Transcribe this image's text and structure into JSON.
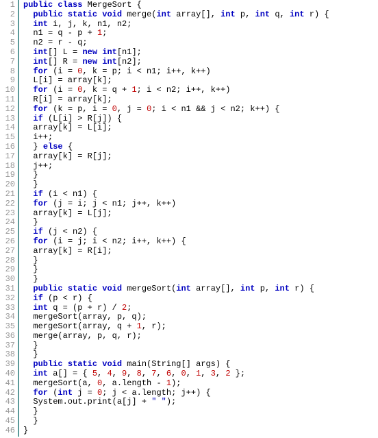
{
  "lines": [
    {
      "n": "1",
      "tokens": [
        [
          "kw",
          "public"
        ],
        [
          "p",
          " "
        ],
        [
          "kw",
          "class"
        ],
        [
          "p",
          " MergeSort {"
        ]
      ]
    },
    {
      "n": "2",
      "tokens": [
        [
          "p",
          "  "
        ],
        [
          "kw",
          "public"
        ],
        [
          "p",
          " "
        ],
        [
          "kw",
          "static"
        ],
        [
          "p",
          " "
        ],
        [
          "kw",
          "void"
        ],
        [
          "p",
          " merge("
        ],
        [
          "kw",
          "int"
        ],
        [
          "p",
          " array[], "
        ],
        [
          "kw",
          "int"
        ],
        [
          "p",
          " p, "
        ],
        [
          "kw",
          "int"
        ],
        [
          "p",
          " q, "
        ],
        [
          "kw",
          "int"
        ],
        [
          "p",
          " r) {"
        ]
      ]
    },
    {
      "n": "3",
      "tokens": [
        [
          "p",
          "  "
        ],
        [
          "kw",
          "int"
        ],
        [
          "p",
          " i, j, k, n1, n2;"
        ]
      ]
    },
    {
      "n": "4",
      "tokens": [
        [
          "p",
          "  n1 = q - p + "
        ],
        [
          "num",
          "1"
        ],
        [
          "p",
          ";"
        ]
      ]
    },
    {
      "n": "5",
      "tokens": [
        [
          "p",
          "  n2 = r - q;"
        ]
      ]
    },
    {
      "n": "6",
      "tokens": [
        [
          "p",
          "  "
        ],
        [
          "kw",
          "int"
        ],
        [
          "p",
          "[] L = "
        ],
        [
          "kw",
          "new"
        ],
        [
          "p",
          " "
        ],
        [
          "kw",
          "int"
        ],
        [
          "p",
          "[n1];"
        ]
      ]
    },
    {
      "n": "7",
      "tokens": [
        [
          "p",
          "  "
        ],
        [
          "kw",
          "int"
        ],
        [
          "p",
          "[] R = "
        ],
        [
          "kw",
          "new"
        ],
        [
          "p",
          " "
        ],
        [
          "kw",
          "int"
        ],
        [
          "p",
          "[n2];"
        ]
      ]
    },
    {
      "n": "8",
      "tokens": [
        [
          "p",
          "  "
        ],
        [
          "kw",
          "for"
        ],
        [
          "p",
          " (i = "
        ],
        [
          "num",
          "0"
        ],
        [
          "p",
          ", k = p; i < n1; i++, k++)"
        ]
      ]
    },
    {
      "n": "9",
      "tokens": [
        [
          "p",
          "  L[i] = array[k];"
        ]
      ]
    },
    {
      "n": "10",
      "tokens": [
        [
          "p",
          "  "
        ],
        [
          "kw",
          "for"
        ],
        [
          "p",
          " (i = "
        ],
        [
          "num",
          "0"
        ],
        [
          "p",
          ", k = q + "
        ],
        [
          "num",
          "1"
        ],
        [
          "p",
          "; i < n2; i++, k++)"
        ]
      ]
    },
    {
      "n": "11",
      "tokens": [
        [
          "p",
          "  R[i] = array[k];"
        ]
      ]
    },
    {
      "n": "12",
      "tokens": [
        [
          "p",
          "  "
        ],
        [
          "kw",
          "for"
        ],
        [
          "p",
          " (k = p, i = "
        ],
        [
          "num",
          "0"
        ],
        [
          "p",
          ", j = "
        ],
        [
          "num",
          "0"
        ],
        [
          "p",
          "; i < n1 && j < n2; k++) {"
        ]
      ]
    },
    {
      "n": "13",
      "tokens": [
        [
          "p",
          "  "
        ],
        [
          "kw",
          "if"
        ],
        [
          "p",
          " (L[i] > R[j]) {"
        ]
      ]
    },
    {
      "n": "14",
      "tokens": [
        [
          "p",
          "  array[k] = L[i];"
        ]
      ]
    },
    {
      "n": "15",
      "tokens": [
        [
          "p",
          "  i++;"
        ]
      ]
    },
    {
      "n": "16",
      "tokens": [
        [
          "p",
          "  } "
        ],
        [
          "kw",
          "else"
        ],
        [
          "p",
          " {"
        ]
      ]
    },
    {
      "n": "17",
      "tokens": [
        [
          "p",
          "  array[k] = R[j];"
        ]
      ]
    },
    {
      "n": "18",
      "tokens": [
        [
          "p",
          "  j++;"
        ]
      ]
    },
    {
      "n": "19",
      "tokens": [
        [
          "p",
          "  }"
        ]
      ]
    },
    {
      "n": "20",
      "tokens": [
        [
          "p",
          "  }"
        ]
      ]
    },
    {
      "n": "21",
      "tokens": [
        [
          "p",
          "  "
        ],
        [
          "kw",
          "if"
        ],
        [
          "p",
          " (i < n1) {"
        ]
      ]
    },
    {
      "n": "22",
      "tokens": [
        [
          "p",
          "  "
        ],
        [
          "kw",
          "for"
        ],
        [
          "p",
          " (j = i; j < n1; j++, k++)"
        ]
      ]
    },
    {
      "n": "23",
      "tokens": [
        [
          "p",
          "  array[k] = L[j];"
        ]
      ]
    },
    {
      "n": "24",
      "tokens": [
        [
          "p",
          "  }"
        ]
      ]
    },
    {
      "n": "25",
      "tokens": [
        [
          "p",
          "  "
        ],
        [
          "kw",
          "if"
        ],
        [
          "p",
          " (j < n2) {"
        ]
      ]
    },
    {
      "n": "26",
      "tokens": [
        [
          "p",
          "  "
        ],
        [
          "kw",
          "for"
        ],
        [
          "p",
          " (i = j; i < n2; i++, k++) {"
        ]
      ]
    },
    {
      "n": "27",
      "tokens": [
        [
          "p",
          "  array[k] = R[i];"
        ]
      ]
    },
    {
      "n": "28",
      "tokens": [
        [
          "p",
          "  }"
        ]
      ]
    },
    {
      "n": "29",
      "tokens": [
        [
          "p",
          "  }"
        ]
      ]
    },
    {
      "n": "30",
      "tokens": [
        [
          "p",
          "  }"
        ]
      ]
    },
    {
      "n": "31",
      "tokens": [
        [
          "p",
          "  "
        ],
        [
          "kw",
          "public"
        ],
        [
          "p",
          " "
        ],
        [
          "kw",
          "static"
        ],
        [
          "p",
          " "
        ],
        [
          "kw",
          "void"
        ],
        [
          "p",
          " mergeSort("
        ],
        [
          "kw",
          "int"
        ],
        [
          "p",
          " array[], "
        ],
        [
          "kw",
          "int"
        ],
        [
          "p",
          " p, "
        ],
        [
          "kw",
          "int"
        ],
        [
          "p",
          " r) {"
        ]
      ]
    },
    {
      "n": "32",
      "tokens": [
        [
          "p",
          "  "
        ],
        [
          "kw",
          "if"
        ],
        [
          "p",
          " (p < r) {"
        ]
      ]
    },
    {
      "n": "33",
      "tokens": [
        [
          "p",
          "  "
        ],
        [
          "kw",
          "int"
        ],
        [
          "p",
          " q = (p + r) / "
        ],
        [
          "num",
          "2"
        ],
        [
          "p",
          ";"
        ]
      ]
    },
    {
      "n": "34",
      "tokens": [
        [
          "p",
          "  mergeSort(array, p, q);"
        ]
      ]
    },
    {
      "n": "35",
      "tokens": [
        [
          "p",
          "  mergeSort(array, q + "
        ],
        [
          "num",
          "1"
        ],
        [
          "p",
          ", r);"
        ]
      ]
    },
    {
      "n": "36",
      "tokens": [
        [
          "p",
          "  merge(array, p, q, r);"
        ]
      ]
    },
    {
      "n": "37",
      "tokens": [
        [
          "p",
          "  }"
        ]
      ]
    },
    {
      "n": "38",
      "tokens": [
        [
          "p",
          "  }"
        ]
      ]
    },
    {
      "n": "39",
      "tokens": [
        [
          "p",
          "  "
        ],
        [
          "kw",
          "public"
        ],
        [
          "p",
          " "
        ],
        [
          "kw",
          "static"
        ],
        [
          "p",
          " "
        ],
        [
          "kw",
          "void"
        ],
        [
          "p",
          " main(String[] args) {"
        ]
      ]
    },
    {
      "n": "40",
      "tokens": [
        [
          "p",
          "  "
        ],
        [
          "kw",
          "int"
        ],
        [
          "p",
          " a[] = { "
        ],
        [
          "num",
          "5"
        ],
        [
          "p",
          ", "
        ],
        [
          "num",
          "4"
        ],
        [
          "p",
          ", "
        ],
        [
          "num",
          "9"
        ],
        [
          "p",
          ", "
        ],
        [
          "num",
          "8"
        ],
        [
          "p",
          ", "
        ],
        [
          "num",
          "7"
        ],
        [
          "p",
          ", "
        ],
        [
          "num",
          "6"
        ],
        [
          "p",
          ", "
        ],
        [
          "num",
          "0"
        ],
        [
          "p",
          ", "
        ],
        [
          "num",
          "1"
        ],
        [
          "p",
          ", "
        ],
        [
          "num",
          "3"
        ],
        [
          "p",
          ", "
        ],
        [
          "num",
          "2"
        ],
        [
          "p",
          " };"
        ]
      ]
    },
    {
      "n": "41",
      "tokens": [
        [
          "p",
          "  mergeSort(a, "
        ],
        [
          "num",
          "0"
        ],
        [
          "p",
          ", a.length - "
        ],
        [
          "num",
          "1"
        ],
        [
          "p",
          ");"
        ]
      ]
    },
    {
      "n": "42",
      "tokens": [
        [
          "p",
          "  "
        ],
        [
          "kw",
          "for"
        ],
        [
          "p",
          " ("
        ],
        [
          "kw",
          "int"
        ],
        [
          "p",
          " j = "
        ],
        [
          "num",
          "0"
        ],
        [
          "p",
          "; j < a.length; j++) {"
        ]
      ]
    },
    {
      "n": "43",
      "tokens": [
        [
          "p",
          "  System.out.print(a[j] + "
        ],
        [
          "str",
          "\" \""
        ],
        [
          "p",
          ");"
        ]
      ]
    },
    {
      "n": "44",
      "tokens": [
        [
          "p",
          "  }"
        ]
      ]
    },
    {
      "n": "45",
      "tokens": [
        [
          "p",
          "  }"
        ]
      ]
    },
    {
      "n": "46",
      "tokens": [
        [
          "p",
          "}"
        ]
      ]
    }
  ]
}
